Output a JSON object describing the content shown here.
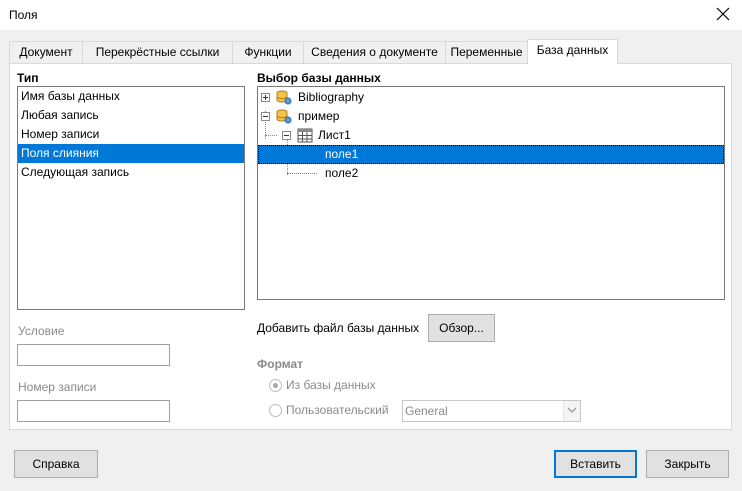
{
  "window": {
    "title": "Поля"
  },
  "tabs": [
    {
      "label": "Документ"
    },
    {
      "label": "Перекрёстные ссылки"
    },
    {
      "label": "Функции"
    },
    {
      "label": "Сведения о документе"
    },
    {
      "label": "Переменные"
    },
    {
      "label": "База данных",
      "active": true
    }
  ],
  "type_section": {
    "label": "Тип",
    "items": [
      {
        "label": "Имя базы данных"
      },
      {
        "label": "Любая запись"
      },
      {
        "label": "Номер записи"
      },
      {
        "label": "Поля слияния",
        "selected": true
      },
      {
        "label": "Следующая запись"
      }
    ]
  },
  "db_section": {
    "label": "Выбор базы данных",
    "tree": {
      "bibliography": "Bibliography",
      "example": "пример",
      "sheet": "Лист1",
      "field1": "поле1",
      "field2": "поле2",
      "selected": "поле1"
    }
  },
  "condition": {
    "label": "Условие",
    "value": ""
  },
  "record_number": {
    "label": "Номер записи",
    "value": ""
  },
  "add_db": {
    "label": "Добавить файл базы данных",
    "browse_button": "Обзор..."
  },
  "format": {
    "label": "Формат",
    "from_db": "Из базы данных",
    "custom": "Пользовательский",
    "selected": "from_db",
    "combo_value": "General"
  },
  "buttons": {
    "help": "Справка",
    "insert": "Вставить",
    "close": "Закрыть"
  },
  "colors": {
    "selection": "#0078d7",
    "dialog_bg": "#f0f0f0",
    "disabled_text": "#8a8a8a"
  }
}
